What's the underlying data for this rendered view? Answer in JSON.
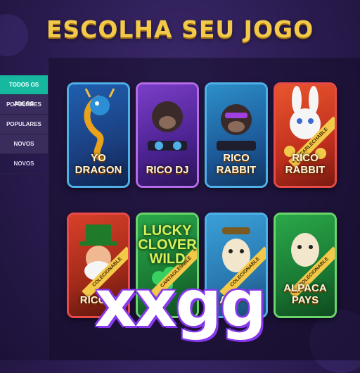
{
  "header": {
    "title": "ESCOLHA SEU JOGO"
  },
  "sidebar": {
    "items": [
      {
        "label": "TODOS OS JOGOS"
      },
      {
        "label": "POPULARES"
      },
      {
        "label": "POPULARES"
      },
      {
        "label": "NOVOS"
      },
      {
        "label": "NOVOS"
      }
    ]
  },
  "games": [
    {
      "name": "YO DRAGON",
      "badge": ""
    },
    {
      "name": "RICO DJ",
      "badge": ""
    },
    {
      "name": "RICO RABBIT",
      "badge": ""
    },
    {
      "name": "RICO RABBIT",
      "badge": "CARLECHABLE"
    },
    {
      "name": "RICO R",
      "badge": "COLECIONABLE"
    },
    {
      "name": "LUCKY CLOVER WILD",
      "badge": "CANTAOLEIABLE"
    },
    {
      "name": "AL P S",
      "badge": "COLECIONABLE"
    },
    {
      "name": "ALPACA PAYS",
      "badge": "COLECIONABLE"
    }
  ],
  "watermark": "xxgg",
  "colors": {
    "accent": "#16b8a0",
    "title": "#f3c94a",
    "card_border": "#5fa7e6"
  }
}
